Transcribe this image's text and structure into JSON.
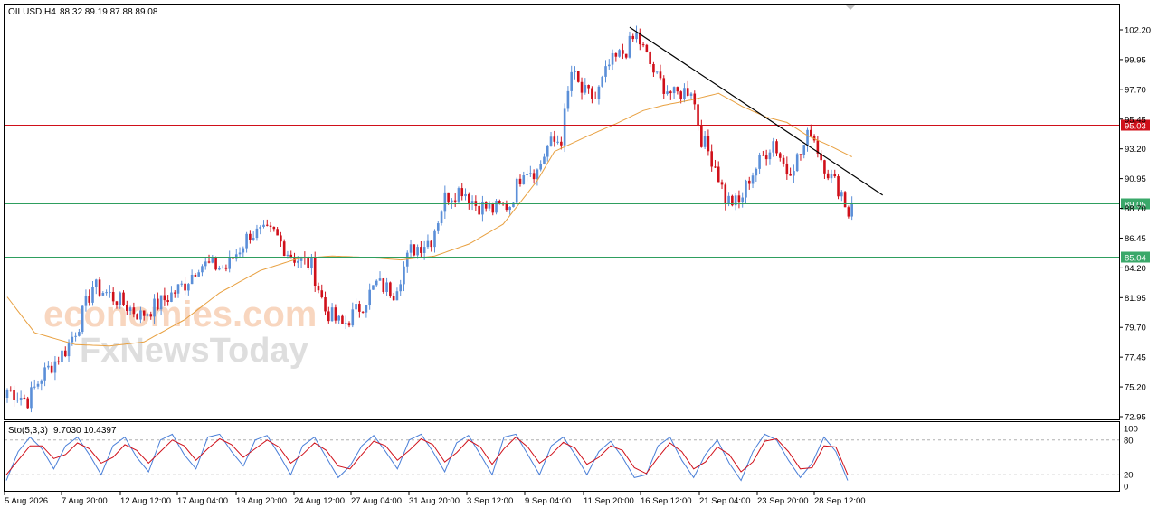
{
  "header": {
    "symbol": "OILUSD,H4",
    "ohlc": "88.32 89.19 87.88 89.08"
  },
  "watermark": {
    "line1": "economies.com",
    "line2": "FxNewsToday"
  },
  "colors": {
    "background": "#ffffff",
    "frame": "#000000",
    "bull_candle": "#5b8fd8",
    "bear_candle": "#d0101a",
    "moving_average": "#e8a040",
    "trendline": "#000000",
    "resistance_line": "#d0101a",
    "support_line": "#2e9e5e",
    "price_badge_red": "#d0101a",
    "price_badge_green": "#3aa86a",
    "stoch_main": "#4a7fd8",
    "stoch_signal": "#d0101a",
    "watermark_orange": "#f2b48a",
    "watermark_gray": "#c8c8c8"
  },
  "chart_data": [
    {
      "type": "candlestick",
      "symbol": "OILUSD",
      "timeframe": "H4",
      "x_ticks": [
        "5 Aug 2026",
        "7 Aug 20:00",
        "12 Aug 12:00",
        "17 Aug 04:00",
        "19 Aug 20:00",
        "24 Aug 12:00",
        "27 Aug 04:00",
        "31 Aug 20:00",
        "3 Sep 12:00",
        "9 Sep 04:00",
        "11 Sep 20:00",
        "16 Sep 12:00",
        "21 Sep 04:00",
        "23 Sep 20:00",
        "28 Sep 12:00"
      ],
      "y_ticks": [
        "102.20",
        "99.95",
        "97.70",
        "95.45",
        "93.20",
        "90.95",
        "88.70",
        "86.45",
        "84.20",
        "81.95",
        "79.70",
        "77.45",
        "75.20",
        "72.95"
      ],
      "ylim": [
        72.95,
        102.2
      ],
      "price_lines": [
        {
          "label": "95.03",
          "value": 95.03,
          "kind": "resistance"
        },
        {
          "label": "89.05",
          "value": 89.05,
          "kind": "current"
        },
        {
          "label": "85.04",
          "value": 85.04,
          "kind": "support"
        }
      ],
      "trendline": {
        "from": {
          "bar": 182,
          "price": 102.4
        },
        "to": {
          "bar": 256,
          "price": 89.7
        }
      },
      "anchors": [
        [
          0,
          75.0
        ],
        [
          6,
          74.2
        ],
        [
          10,
          76.0
        ],
        [
          17,
          78.0
        ],
        [
          21,
          80.0
        ],
        [
          25,
          82.8
        ],
        [
          29,
          82.3
        ],
        [
          34,
          81.5
        ],
        [
          39,
          80.6
        ],
        [
          45,
          81.6
        ],
        [
          52,
          83.0
        ],
        [
          56,
          84.5
        ],
        [
          64,
          84.2
        ],
        [
          71,
          86.8
        ],
        [
          78,
          86.8
        ],
        [
          83,
          85.1
        ],
        [
          89,
          84.4
        ],
        [
          93,
          81.0
        ],
        [
          98,
          79.8
        ],
        [
          104,
          81.5
        ],
        [
          108,
          83.0
        ],
        [
          113,
          82.4
        ],
        [
          118,
          85.5
        ],
        [
          124,
          86.4
        ],
        [
          128,
          89.5
        ],
        [
          133,
          90.2
        ],
        [
          137,
          89.0
        ],
        [
          142,
          88.6
        ],
        [
          147,
          89.0
        ],
        [
          151,
          91.8
        ],
        [
          155,
          91.5
        ],
        [
          158,
          93.4
        ],
        [
          162,
          94.0
        ],
        [
          165,
          99.0
        ],
        [
          168,
          97.5
        ],
        [
          172,
          97.0
        ],
        [
          176,
          99.5
        ],
        [
          181,
          100.7
        ],
        [
          184,
          101.8
        ],
        [
          190,
          98.5
        ],
        [
          195,
          97.2
        ],
        [
          200,
          97.8
        ],
        [
          203,
          94.0
        ],
        [
          207,
          92.0
        ],
        [
          210,
          89.4
        ],
        [
          214,
          89.0
        ],
        [
          217,
          91.0
        ],
        [
          220,
          92.2
        ],
        [
          224,
          93.8
        ],
        [
          228,
          91.5
        ],
        [
          232,
          92.8
        ],
        [
          235,
          94.7
        ],
        [
          238,
          92.5
        ],
        [
          241,
          91.0
        ],
        [
          244,
          89.9
        ],
        [
          246,
          88.3
        ],
        [
          247,
          89.08
        ]
      ],
      "moving_average": {
        "anchors": [
          [
            0,
            82.0
          ],
          [
            8,
            79.3
          ],
          [
            20,
            78.4
          ],
          [
            30,
            78.3
          ],
          [
            40,
            78.6
          ],
          [
            52,
            80.3
          ],
          [
            62,
            82.3
          ],
          [
            74,
            84.0
          ],
          [
            85,
            84.9
          ],
          [
            95,
            85.1
          ],
          [
            105,
            85.0
          ],
          [
            115,
            84.8
          ],
          [
            125,
            85.1
          ],
          [
            135,
            86.0
          ],
          [
            145,
            87.5
          ],
          [
            155,
            90.8
          ],
          [
            160,
            93.0
          ],
          [
            170,
            94.2
          ],
          [
            178,
            95.1
          ],
          [
            186,
            96.1
          ],
          [
            192,
            96.5
          ],
          [
            200,
            96.9
          ],
          [
            208,
            97.4
          ],
          [
            215,
            96.4
          ],
          [
            222,
            95.6
          ],
          [
            228,
            95.2
          ],
          [
            234,
            94.2
          ],
          [
            240,
            93.5
          ],
          [
            247,
            92.6
          ]
        ]
      }
    },
    {
      "type": "line",
      "title": "Sto(5,3,3)",
      "values_text": "9.7030 10.4397",
      "y_ticks": [
        "100",
        "80",
        "20",
        "0"
      ],
      "levels": [
        80,
        20
      ],
      "ylim": [
        0,
        100
      ],
      "series": [
        {
          "name": "main",
          "values": [
            10,
            60,
            85,
            65,
            30,
            70,
            85,
            55,
            20,
            70,
            85,
            50,
            25,
            80,
            90,
            55,
            30,
            85,
            90,
            60,
            35,
            80,
            88,
            55,
            20,
            70,
            85,
            50,
            15,
            35,
            70,
            88,
            60,
            30,
            80,
            90,
            60,
            25,
            75,
            88,
            55,
            20,
            85,
            90,
            55,
            20,
            70,
            85,
            55,
            20,
            60,
            78,
            50,
            15,
            20,
            70,
            85,
            45,
            15,
            55,
            80,
            40,
            10,
            60,
            90,
            80,
            45,
            15,
            40,
            85,
            60,
            10
          ]
        },
        {
          "name": "signal",
          "values": [
            20,
            45,
            70,
            70,
            48,
            55,
            75,
            65,
            40,
            50,
            72,
            62,
            40,
            60,
            80,
            70,
            45,
            65,
            82,
            72,
            50,
            65,
            80,
            68,
            40,
            55,
            75,
            62,
            35,
            30,
            55,
            78,
            70,
            45,
            62,
            82,
            72,
            42,
            58,
            80,
            68,
            38,
            65,
            85,
            68,
            40,
            55,
            76,
            66,
            38,
            50,
            70,
            62,
            32,
            22,
            50,
            75,
            60,
            30,
            42,
            68,
            55,
            25,
            42,
            78,
            82,
            60,
            30,
            32,
            70,
            68,
            20
          ]
        }
      ]
    }
  ]
}
